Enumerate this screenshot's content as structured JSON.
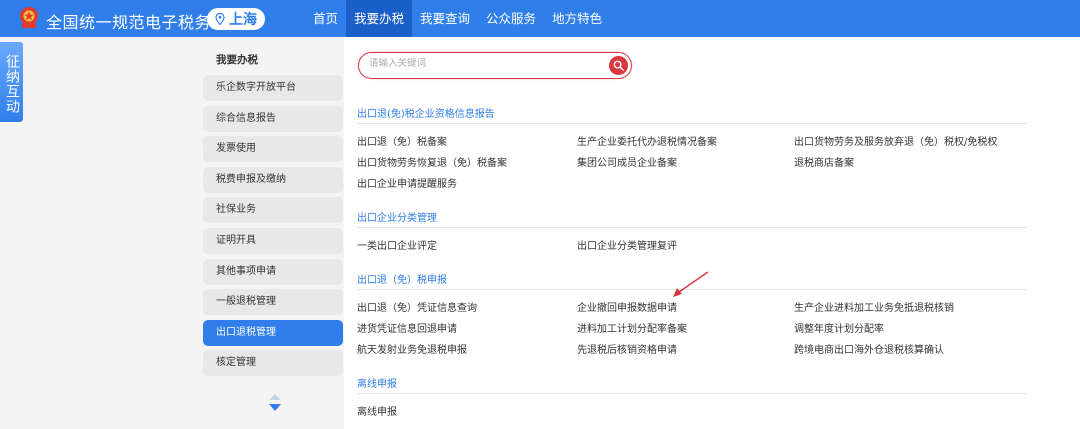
{
  "header": {
    "site_title": "全国统一规范电子税务局",
    "region": "上海",
    "nav": [
      "首页",
      "我要办税",
      "我要查询",
      "公众服务",
      "地方特色"
    ],
    "active_nav_index": 1,
    "brand_color": "#2f7ee9"
  },
  "side_tab": {
    "label": "征纳互动"
  },
  "left_menu": {
    "title": "我要办税",
    "items": [
      "乐企数字开放平台",
      "综合信息报告",
      "发票使用",
      "税费申报及缴纳",
      "社保业务",
      "证明开具",
      "其他事项申请",
      "一般退税管理",
      "出口退税管理",
      "核定管理"
    ],
    "active_index": 8
  },
  "search": {
    "placeholder": "请输入关键词",
    "icon": "search-icon"
  },
  "sections": [
    {
      "title": "出口退(免)税企业资格信息报告",
      "links": [
        [
          "出口退（免）税备案",
          "生产企业委托代办退税情况备案",
          "出口货物劳务及服务放弃退（免）税权/免税权"
        ],
        [
          "出口货物劳务恢复退（免）税备案",
          "集团公司成员企业备案",
          "退税商店备案"
        ],
        [
          "出口企业申请提醒服务",
          "",
          ""
        ]
      ]
    },
    {
      "title": "出口企业分类管理",
      "links": [
        [
          "一类出口企业评定",
          "出口企业分类管理复评",
          ""
        ]
      ]
    },
    {
      "title": "出口退（免）税申报",
      "links": [
        [
          "出口退（免）凭证信息查询",
          "企业撤回申报数据申请",
          "生产企业进料加工业务免抵退税核销"
        ],
        [
          "进货凭证信息回退申请",
          "进料加工计划分配率备案",
          "调整年度计划分配率"
        ],
        [
          "航天发射业务免退税申报",
          "先退税后核销资格申请",
          "跨境电商出口海外仓退税核算确认"
        ]
      ]
    },
    {
      "title": "离线申报",
      "links": [
        [
          "离线申报",
          "",
          ""
        ]
      ]
    }
  ],
  "annotation_color": "#d9363e"
}
